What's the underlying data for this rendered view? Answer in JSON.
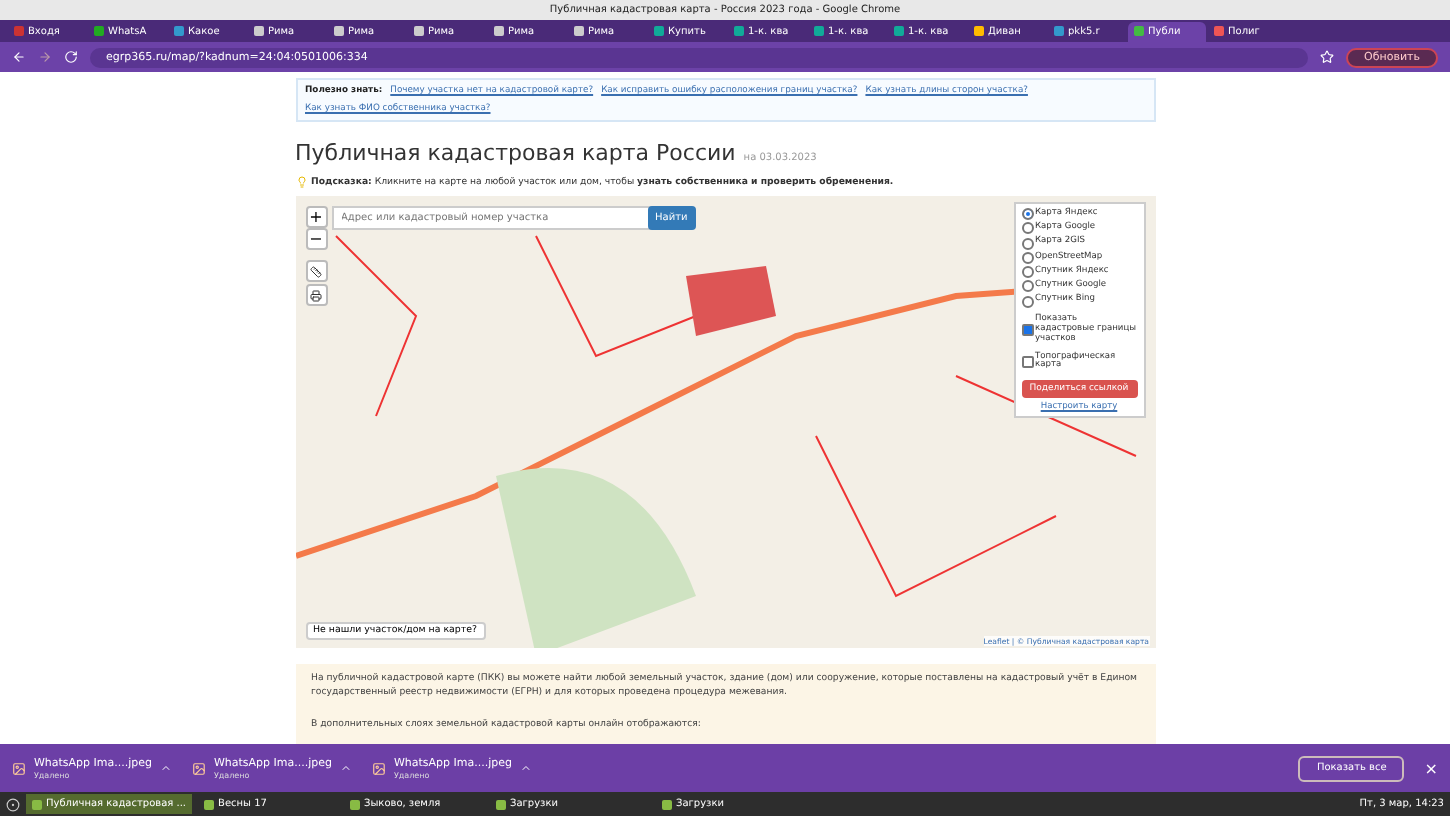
{
  "window": {
    "title": "Публичная кадастровая карта - Россия 2023 года - Google Chrome"
  },
  "tabs": [
    {
      "label": "Входя",
      "selected": false
    },
    {
      "label": "WhatsA",
      "selected": false
    },
    {
      "label": "Какое",
      "selected": false
    },
    {
      "label": "Рима",
      "selected": false
    },
    {
      "label": "Рима",
      "selected": false
    },
    {
      "label": "Рима",
      "selected": false
    },
    {
      "label": "Рима",
      "selected": false
    },
    {
      "label": "Рима",
      "selected": false
    },
    {
      "label": "Купить",
      "selected": false
    },
    {
      "label": "1-к. ква",
      "selected": false
    },
    {
      "label": "1-к. ква",
      "selected": false
    },
    {
      "label": "1-к. ква",
      "selected": false
    },
    {
      "label": "Диван",
      "selected": false
    },
    {
      "label": "pkk5.r",
      "selected": false
    },
    {
      "label": "Публи",
      "selected": true
    },
    {
      "label": "Полиг",
      "selected": false
    }
  ],
  "address_bar": {
    "url": "egrp365.ru/map/?kadnum=24:04:0501006:334",
    "update_button": "Обновить"
  },
  "useful": {
    "label": "Полезно знать:",
    "links": [
      "Почему участка нет на кадастровой карте?",
      "Как исправить ошибку расположения границ участка?",
      "Как узнать длины сторон участка?",
      "Как узнать ФИО собственника участка?"
    ]
  },
  "heading": {
    "title": "Публичная кадастровая карта России",
    "date": "на 03.03.2023"
  },
  "hint": "**Подсказка:** Кликните на карте на любой участок или дом, чтобы **узнать собственника и проверить обременения.**",
  "map": {
    "search": {
      "placeholder": "Адрес или кадастровый номер участка",
      "button": "Найти"
    },
    "zoom": [
      "+",
      "−"
    ],
    "layers": [
      {
        "label": "Карта Яндекс",
        "selected": true
      },
      {
        "label": "Карта Google",
        "selected": false
      },
      {
        "label": "Карта 2GIS",
        "selected": false
      },
      {
        "label": "OpenStreetMap",
        "selected": false
      },
      {
        "label": "Спутник Яндекс",
        "selected": false
      },
      {
        "label": "Спутник Google",
        "selected": false
      },
      {
        "label": "Спутник Bing",
        "selected": false
      }
    ],
    "options": [
      {
        "label": "Показать кадастровые границы участков",
        "checked": true
      },
      {
        "label": "Топографическая карта",
        "checked": false
      }
    ],
    "share_button": "Поделиться ссылкой",
    "settings_link": "Настроить карту",
    "not_found": "Не нашли участок/дом на карте?",
    "attribution": "Leaflet | © Публичная кадастровая карта"
  },
  "info": [
    "На публичной кадастровой карте (ПКК) вы можете найти любой земельный участок, здание (дом) или сооружение, которые поставлены на кадастровый учёт в Едином государственный реестр недвижимости (ЕГРН) и для которых проведена процедура межевания.",
    "В дополнительных слоях земельной кадастровой карты онлайн отображаются:"
  ],
  "downloads": {
    "items": [
      {
        "name": "WhatsApp Ima....jpeg",
        "status": "Удалено"
      },
      {
        "name": "WhatsApp Ima....jpeg",
        "status": "Удалено"
      },
      {
        "name": "WhatsApp Ima....jpeg",
        "status": "Удалено"
      }
    ],
    "show_all": "Показать все",
    "close": "×"
  },
  "taskbar": {
    "items": [
      {
        "label": "Публичная кадастровая ...",
        "selected": true
      },
      {
        "label": "Весны 17",
        "selected": false
      },
      {
        "label": "Зыково, земля",
        "selected": false
      },
      {
        "label": "Загрузки",
        "selected": false
      },
      {
        "label": "Загрузки",
        "selected": false
      }
    ],
    "clock": "Пт, 3 мар, 14:23"
  }
}
